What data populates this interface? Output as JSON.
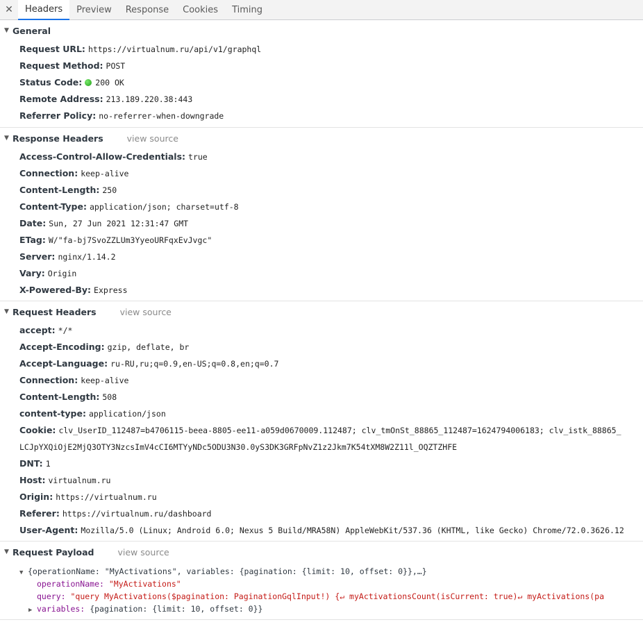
{
  "tabs": {
    "close": "✕",
    "items": [
      "Headers",
      "Preview",
      "Response",
      "Cookies",
      "Timing"
    ],
    "active": "Headers"
  },
  "general": {
    "title": "General",
    "rows": [
      {
        "key": "Request URL:",
        "value": "https://virtualnum.ru/api/v1/graphql"
      },
      {
        "key": "Request Method:",
        "value": "POST"
      },
      {
        "key": "Status Code:",
        "value": "200 OK",
        "status_color": "#2ca42a"
      },
      {
        "key": "Remote Address:",
        "value": "213.189.220.38:443"
      },
      {
        "key": "Referrer Policy:",
        "value": "no-referrer-when-downgrade"
      }
    ]
  },
  "response_headers": {
    "title": "Response Headers",
    "view_source": "view source",
    "rows": [
      {
        "key": "Access-Control-Allow-Credentials:",
        "value": "true"
      },
      {
        "key": "Connection:",
        "value": "keep-alive"
      },
      {
        "key": "Content-Length:",
        "value": "250"
      },
      {
        "key": "Content-Type:",
        "value": "application/json; charset=utf-8"
      },
      {
        "key": "Date:",
        "value": "Sun, 27 Jun 2021 12:31:47 GMT"
      },
      {
        "key": "ETag:",
        "value": "W/\"fa-bj7SvoZZLUm3YyeoURFqxEvJvgc\""
      },
      {
        "key": "Server:",
        "value": "nginx/1.14.2"
      },
      {
        "key": "Vary:",
        "value": "Origin"
      },
      {
        "key": "X-Powered-By:",
        "value": "Express"
      }
    ]
  },
  "request_headers": {
    "title": "Request Headers",
    "view_source": "view source",
    "rows": [
      {
        "key": "accept:",
        "value": "*/*"
      },
      {
        "key": "Accept-Encoding:",
        "value": "gzip, deflate, br"
      },
      {
        "key": "Accept-Language:",
        "value": "ru-RU,ru;q=0.9,en-US;q=0.8,en;q=0.7"
      },
      {
        "key": "Connection:",
        "value": "keep-alive"
      },
      {
        "key": "Content-Length:",
        "value": "508"
      },
      {
        "key": "content-type:",
        "value": "application/json"
      },
      {
        "key": "Cookie:",
        "value": "clv_UserID_112487=b4706115-beea-8805-ee11-a059d0670009.112487; clv_tmOnSt_88865_112487=1624794006183; clv_istk_88865_"
      },
      {
        "key": "",
        "value": "LCJpYXQiOjE2MjQ3OTY3NzcsImV4cCI6MTYyNDc5ODU3N30.0yS3DK3GRFpNvZ1z2Jkm7K54tXM8W2Z11l_OQZTZHFE"
      },
      {
        "key": "DNT:",
        "value": "1"
      },
      {
        "key": "Host:",
        "value": "virtualnum.ru"
      },
      {
        "key": "Origin:",
        "value": "https://virtualnum.ru"
      },
      {
        "key": "Referer:",
        "value": "https://virtualnum.ru/dashboard"
      },
      {
        "key": "User-Agent:",
        "value": "Mozilla/5.0 (Linux; Android 6.0; Nexus 5 Build/MRA58N) AppleWebKit/537.36 (KHTML, like Gecko) Chrome/72.0.3626.12"
      }
    ]
  },
  "payload": {
    "title": "Request Payload",
    "view_source": "view source",
    "summary": "{operationName: \"MyActivations\", variables: {pagination: {limit: 10, offset: 0}},…}",
    "op_key": "operationName:",
    "op_value": "\"MyActivations\"",
    "query_key": "query:",
    "query_value": "\"query MyActivations($pagination: PaginationGqlInput!) {↵  myActivationsCount(isCurrent: true)↵  myActivations(pa",
    "vars_key": "variables:",
    "vars_value": "{pagination: {limit: 10, offset: 0}}"
  }
}
